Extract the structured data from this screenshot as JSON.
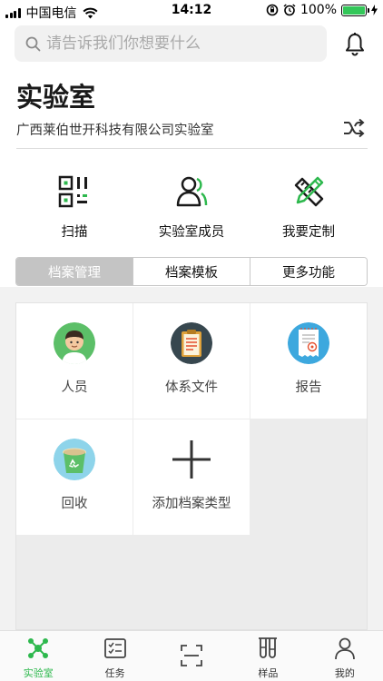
{
  "status_bar": {
    "carrier": "中国电信",
    "time": "14:12",
    "battery_percent": "100%",
    "battery_level": 1.0
  },
  "search": {
    "placeholder": "请告诉我们你想要什么"
  },
  "header": {
    "title": "实验室",
    "org_name": "广西莱伯世开科技有限公司实验室"
  },
  "quick_actions": [
    {
      "label": "扫描",
      "icon": "qr-scan-icon"
    },
    {
      "label": "实验室成员",
      "icon": "members-icon"
    },
    {
      "label": "我要定制",
      "icon": "customize-icon"
    }
  ],
  "tabs": [
    {
      "label": "档案管理",
      "active": true
    },
    {
      "label": "档案模板",
      "active": false
    },
    {
      "label": "更多功能",
      "active": false
    }
  ],
  "grid_items": [
    {
      "label": "人员",
      "icon": "person-avatar-icon"
    },
    {
      "label": "体系文件",
      "icon": "clipboard-icon"
    },
    {
      "label": "报告",
      "icon": "report-icon"
    },
    {
      "label": "回收",
      "icon": "recycle-bin-icon"
    },
    {
      "label": "添加档案类型",
      "icon": "plus-icon"
    }
  ],
  "bottom_nav": [
    {
      "label": "实验室",
      "icon": "lab-molecule-icon",
      "active": true
    },
    {
      "label": "任务",
      "icon": "task-checklist-icon",
      "active": false
    },
    {
      "label": "",
      "icon": "scan-frame-icon",
      "active": false
    },
    {
      "label": "样品",
      "icon": "test-tubes-icon",
      "active": false
    },
    {
      "label": "我的",
      "icon": "profile-icon",
      "active": false
    }
  ],
  "colors": {
    "accent_green": "#2db84d",
    "active_tab_bg": "#c4c4c4",
    "search_bg": "#f1f1f1"
  }
}
